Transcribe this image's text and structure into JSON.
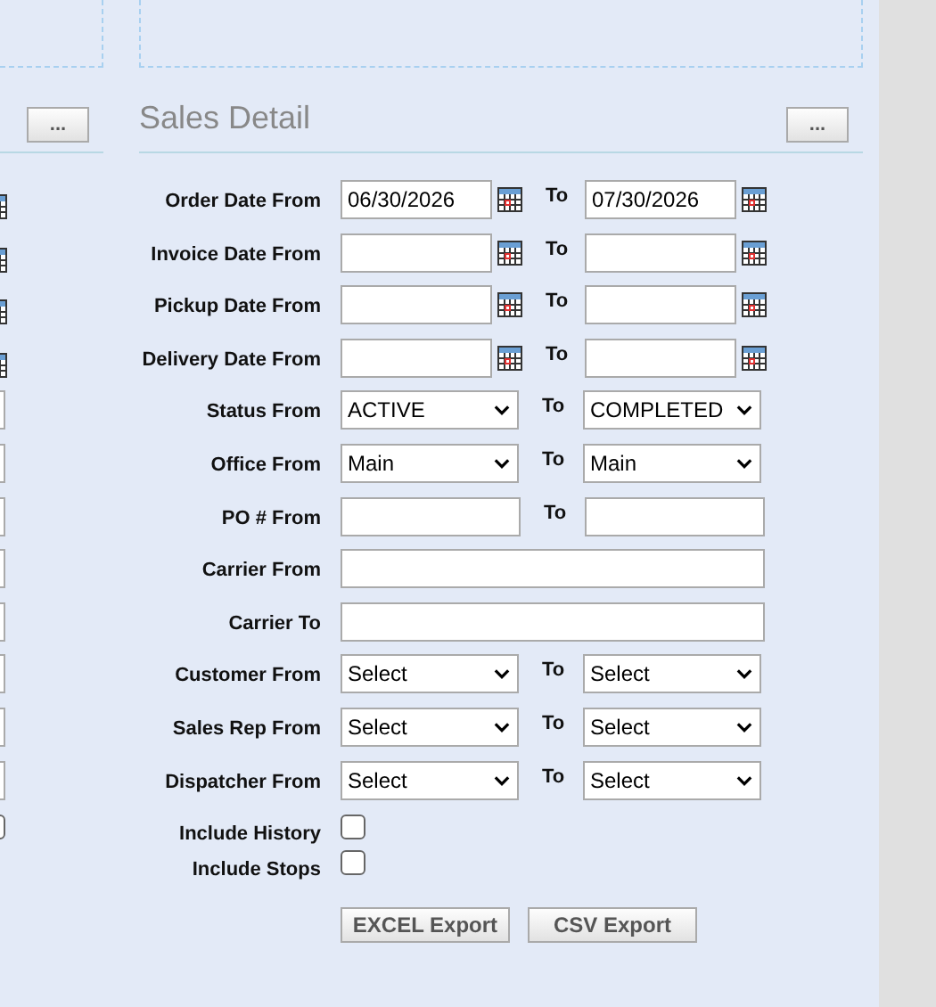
{
  "left_panel": {
    "button": "...",
    "rows": [
      {
        "kind": "date"
      },
      {
        "kind": "date"
      },
      {
        "kind": "date"
      },
      {
        "kind": "date"
      },
      {
        "kind": "field"
      },
      {
        "kind": "field"
      },
      {
        "kind": "field"
      },
      {
        "kind": "field"
      },
      {
        "kind": "field"
      },
      {
        "kind": "field"
      },
      {
        "kind": "field"
      },
      {
        "kind": "field"
      },
      {
        "kind": "checkbox",
        "checked": false
      }
    ]
  },
  "section": {
    "title": "Sales Detail",
    "button": "..."
  },
  "rows": [
    {
      "kind": "date",
      "label": "Order Date From",
      "from": "06/30/2026",
      "to_label": "To",
      "to": "07/30/2026"
    },
    {
      "kind": "date",
      "label": "Invoice Date From",
      "from": "",
      "to_label": "To",
      "to": ""
    },
    {
      "kind": "date",
      "label": "Pickup Date From",
      "from": "",
      "to_label": "To",
      "to": ""
    },
    {
      "kind": "date",
      "label": "Delivery Date From",
      "from": "",
      "to_label": "To",
      "to": ""
    },
    {
      "kind": "select",
      "label": "Status From",
      "from": "ACTIVE",
      "to_label": "To",
      "to": "COMPLETED"
    },
    {
      "kind": "select",
      "label": "Office From",
      "from": "Main",
      "to_label": "To",
      "to": "Main"
    },
    {
      "kind": "text",
      "label": "PO # From",
      "from": "",
      "to_label": "To",
      "to": ""
    },
    {
      "kind": "wide",
      "label": "Carrier From",
      "from": ""
    },
    {
      "kind": "wide",
      "label": "Carrier To",
      "from": ""
    },
    {
      "kind": "select",
      "label": "Customer From",
      "from": "Select",
      "to_label": "To",
      "to": "Select"
    },
    {
      "kind": "select",
      "label": "Sales Rep From",
      "from": "Select",
      "to_label": "To",
      "to": "Select"
    },
    {
      "kind": "select",
      "label": "Dispatcher From",
      "from": "Select",
      "to_label": "To",
      "to": "Select"
    },
    {
      "kind": "checkbox",
      "label": "Include History",
      "checked": false
    },
    {
      "kind": "checkbox",
      "label": "Include Stops",
      "checked": false
    }
  ],
  "buttons": [
    "EXCEL Export",
    "CSV Export"
  ]
}
